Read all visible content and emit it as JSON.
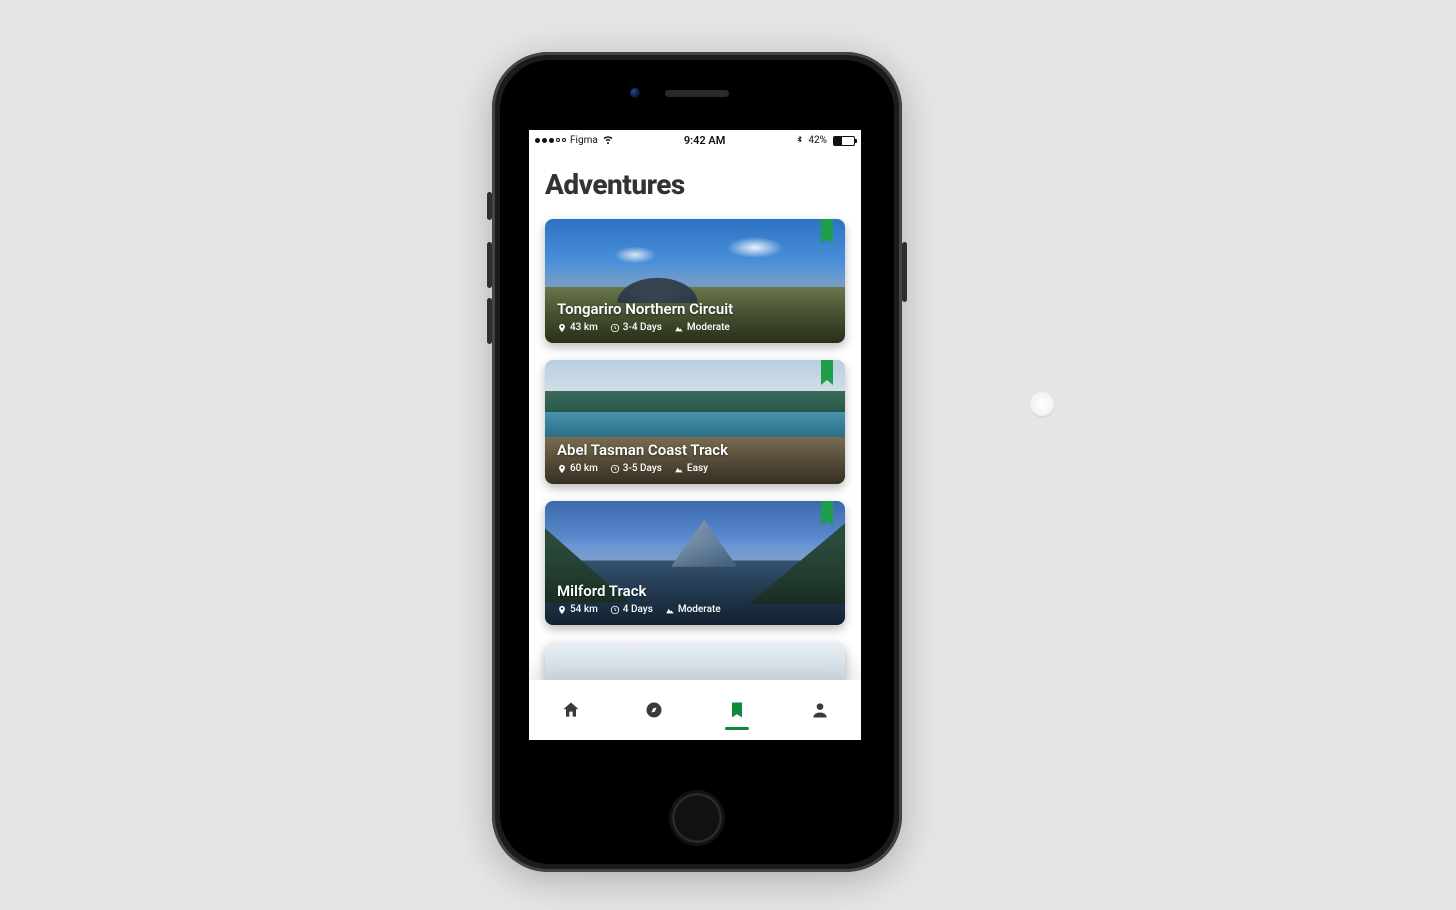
{
  "status": {
    "carrier": "Figma",
    "time": "9:42 AM",
    "battery_pct": "42%",
    "battery_fill_pct": 42
  },
  "page": {
    "title": "Adventures"
  },
  "cards": [
    {
      "name": "Tongariro Northern Circuit",
      "distance": "43 km",
      "duration": "3-4 Days",
      "difficulty": "Moderate"
    },
    {
      "name": "Abel Tasman Coast Track",
      "distance": "60 km",
      "duration": "3-5 Days",
      "difficulty": "Easy"
    },
    {
      "name": "Milford Track",
      "distance": "54 km",
      "duration": "4 Days",
      "difficulty": "Moderate"
    }
  ],
  "tabs": {
    "active_index": 2
  },
  "colors": {
    "accent_green": "#0f8a3a"
  }
}
